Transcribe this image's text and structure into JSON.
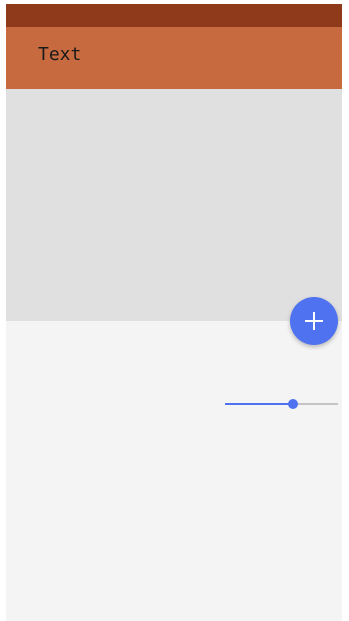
{
  "app_bar": {
    "title": "Text",
    "color": "#c86a40"
  },
  "status_bar": {
    "color": "#8f3b1b"
  },
  "fab": {
    "icon": "plus-icon",
    "color": "#4f72f0"
  },
  "slider": {
    "value": 0.6,
    "accent_color": "#4f72f0",
    "track_color": "#c4c4c4"
  }
}
